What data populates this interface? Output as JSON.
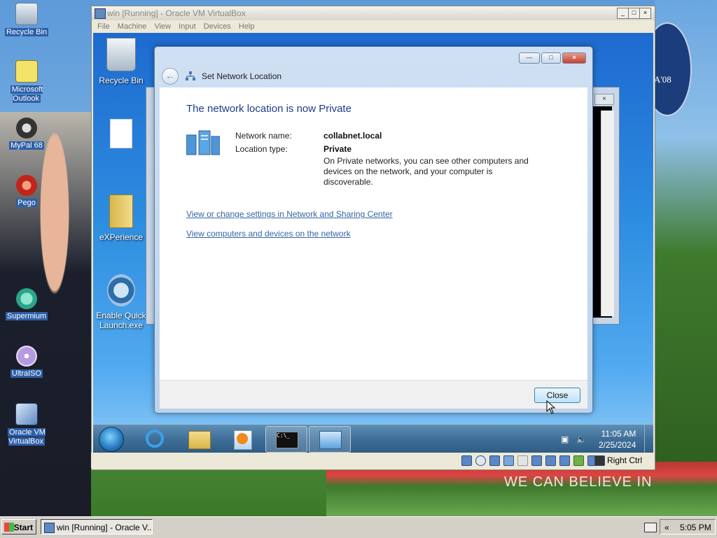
{
  "host": {
    "desktop_icons": [
      {
        "label": "Recycle Bin",
        "icon": "recycle-bin-icon"
      },
      {
        "label": "Microsoft Outlook",
        "icon": "outlook-icon"
      },
      {
        "label": "MyPal 68",
        "icon": "mypal-icon"
      },
      {
        "label": "Pego",
        "icon": "pego-icon"
      },
      {
        "label": "Supermium",
        "icon": "supermium-icon"
      },
      {
        "label": "UltraISO",
        "icon": "ultraiso-icon"
      },
      {
        "label": "Oracle VM VirtualBox",
        "icon": "virtualbox-icon"
      }
    ],
    "wallpaper_badge": "A'08",
    "wallpaper_slogan": "WE CAN BELIEVE IN",
    "taskbar": {
      "start_label": "Start",
      "task_label": "win [Running] - Oracle V...",
      "tray_expand": "«",
      "clock": "5:05 PM"
    }
  },
  "vbox": {
    "title": "win [Running] - Oracle VM VirtualBox",
    "menu": [
      "File",
      "Machine",
      "View",
      "Input",
      "Devices",
      "Help"
    ],
    "status_host_key": "Right Ctrl"
  },
  "guest": {
    "desktop_icons": [
      {
        "label": "Recycle Bin",
        "icon": "recycle-bin-icon"
      },
      {
        "label": "",
        "icon": "file-icon"
      },
      {
        "label": "eXPerience",
        "icon": "folder-icon"
      },
      {
        "label": "Enable Quick Launch.exe",
        "icon": "quick-launch-icon"
      }
    ],
    "taskbar": {
      "time": "11:05 AM",
      "date": "2/25/2024"
    }
  },
  "dialog": {
    "title": "Set Network Location",
    "heading": "The network location is now Private",
    "network_name_label": "Network name:",
    "network_name_value": "collabnet.local",
    "location_type_label": "Location type:",
    "location_type_value": "Private",
    "description": "On Private networks, you can see other computers and devices on the network, and your computer is discoverable.",
    "link_settings": "View or change settings in Network and Sharing Center",
    "link_devices": "View computers and devices on the network",
    "close_button": "Close"
  },
  "colors": {
    "heading_blue": "#1e3c8c",
    "link_blue": "#3465a4",
    "taskbar_blue": "#3f6f98"
  }
}
